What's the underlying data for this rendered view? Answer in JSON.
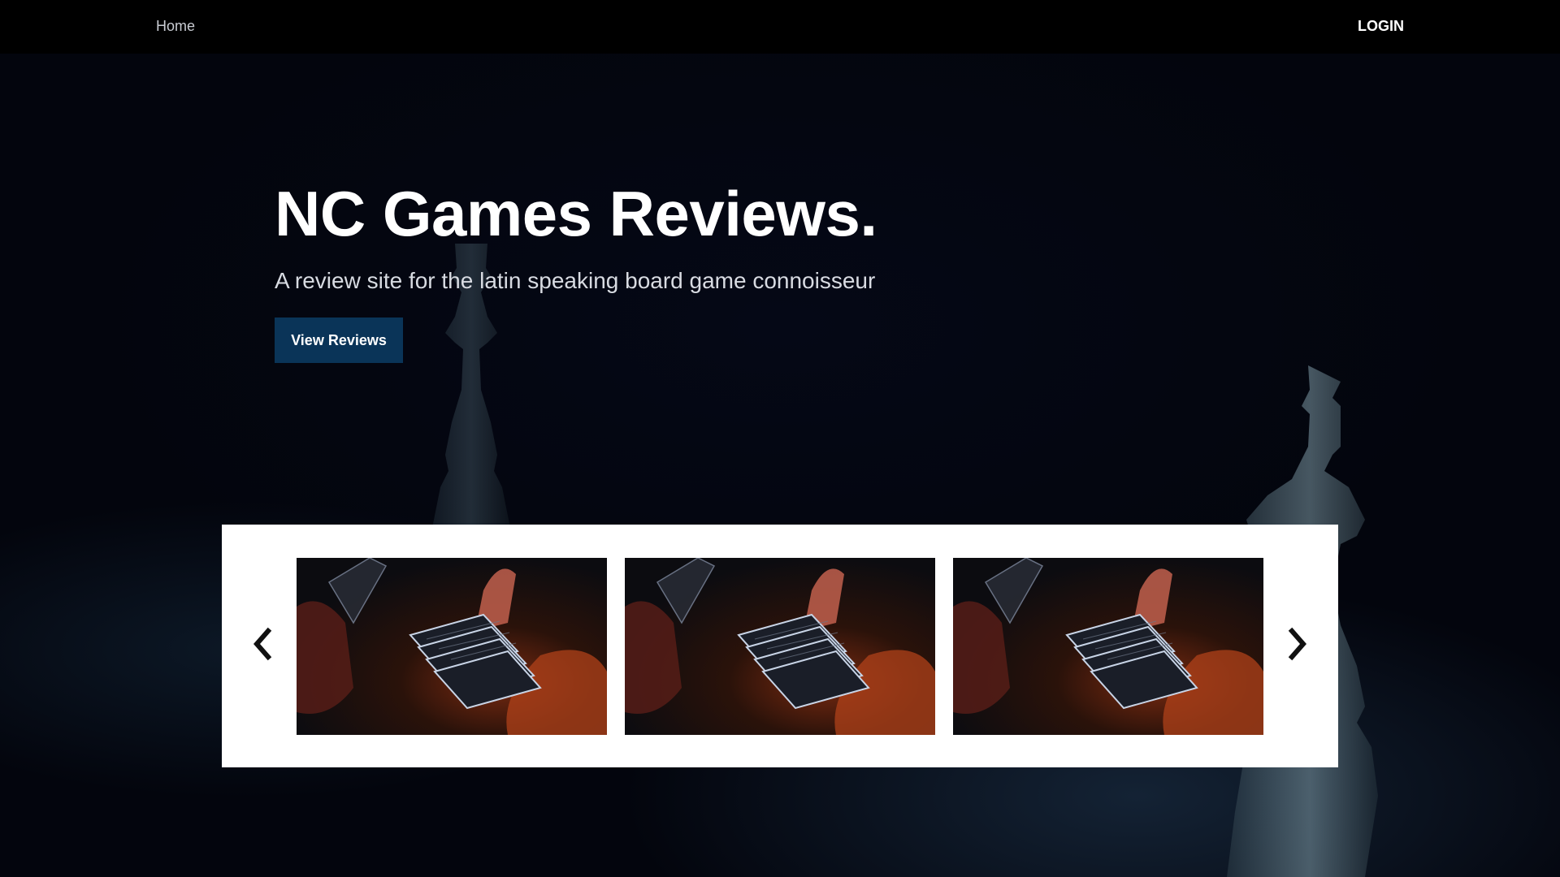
{
  "nav": {
    "home_label": "Home",
    "login_label": "LOGIN"
  },
  "hero": {
    "title": "NC Games Reviews.",
    "subtitle": "A review site for the latin speaking board game connoisseur",
    "button_label": "View Reviews"
  },
  "carousel": {
    "prev_icon": "chevron-left-icon",
    "next_icon": "chevron-right-icon",
    "slides": [
      {
        "image": "playing-cards-in-hand-photo"
      },
      {
        "image": "playing-cards-in-hand-photo"
      },
      {
        "image": "playing-cards-in-hand-photo"
      }
    ]
  },
  "colors": {
    "navbar_bg": "#000000",
    "hero_bg": "#03050d",
    "button_bg": "#0a3458",
    "carousel_bg": "#ffffff"
  }
}
